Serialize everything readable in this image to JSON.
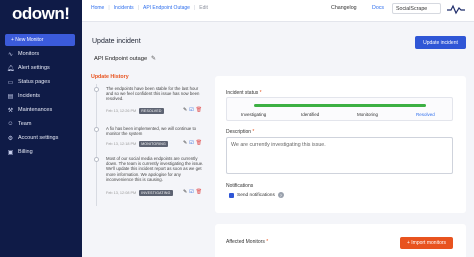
{
  "brand": {
    "logo": "odown!"
  },
  "sidebar": {
    "new_monitor": "+ New Monitor",
    "items": [
      {
        "label": "Monitors",
        "icon": "activity-icon"
      },
      {
        "label": "Alert settings",
        "icon": "bell-icon"
      },
      {
        "label": "Status pages",
        "icon": "status-page-icon"
      },
      {
        "label": "Incidents",
        "icon": "incidents-icon"
      },
      {
        "label": "Maintenances",
        "icon": "maintenance-icon"
      },
      {
        "label": "Team",
        "icon": "team-icon"
      },
      {
        "label": "Account settings",
        "icon": "gear-icon"
      },
      {
        "label": "Billing",
        "icon": "billing-icon"
      }
    ]
  },
  "topbar": {
    "crumbs": [
      "Home",
      "Incidents",
      "API Endpoint Outage",
      "Edit"
    ],
    "changelog": "Changelog",
    "docs": "Docs",
    "account": "SocialScrape"
  },
  "page": {
    "title": "Update incident",
    "update_button": "Update incident",
    "incident_name": "API Endpoint outage"
  },
  "history": {
    "title": "Update History",
    "entries": [
      {
        "text": "The endpoints have been stable for the last hour and so we feel confident this issue has now been resolved.",
        "time": "Feb 13, 12:26 PM",
        "status": "RESOLVED"
      },
      {
        "text": "A fix has been implemented, we will continue to monitor the system",
        "time": "Feb 13, 12:18 PM",
        "status": "MONITORING"
      },
      {
        "text": "Most of our social media endpoints are currently down. The team is currently investigating the issue. We'll update this incident report as soon as we get more information. We apologise for any inconvenience this is causing.",
        "time": "Feb 13, 12:08 PM",
        "status": "INVESTIGATING"
      }
    ]
  },
  "form": {
    "status_label": "Incident status",
    "required_mark": "*",
    "steps": [
      "Investigating",
      "Identified",
      "Monitoring",
      "Resolved"
    ],
    "active_step": "Resolved",
    "progress_fraction": 1.0,
    "description_label": "Description",
    "description_value": "We are currently investigating this issue.",
    "notifications_label": "Notifications",
    "send_notifications": "Send notifications",
    "send_notifications_checked": true,
    "affected_label": "Affected Monitors",
    "import_button": "+ Import monitors"
  },
  "colors": {
    "sidebar_bg": "#0f1b47",
    "primary": "#2f56d6",
    "accent_orange": "#e8531f",
    "progress_green": "#3cb043"
  }
}
